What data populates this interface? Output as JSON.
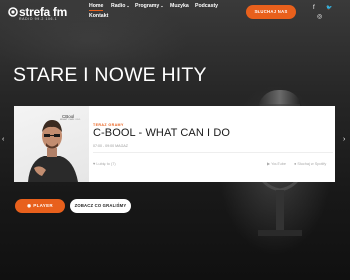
{
  "logo": {
    "name": "strefa fm",
    "tagline": "RADIO 99.2 106.1"
  },
  "nav": {
    "items": [
      {
        "label": "Home",
        "has_caret": false,
        "active": true
      },
      {
        "label": "Radio",
        "has_caret": true,
        "active": false
      },
      {
        "label": "Programy",
        "has_caret": true,
        "active": false
      },
      {
        "label": "Muzyka",
        "has_caret": false,
        "active": false
      },
      {
        "label": "Podcasty",
        "has_caret": false,
        "active": false
      },
      {
        "label": "Kontakt",
        "has_caret": false,
        "active": false
      }
    ],
    "caret": "⌄"
  },
  "header": {
    "listen_label": "SŁUCHAJ NAS",
    "social": {
      "facebook": "f",
      "twitter": "🐦",
      "instagram": "◎"
    }
  },
  "hero": {
    "title": "STARE I NOWE HITY",
    "prev_arrow": "‹",
    "next_arrow": "›"
  },
  "now_playing": {
    "label": "TERAZ GRAMY",
    "title": "C-BOOL - WHAT CAN I DO",
    "time": "07:00 - 09:00 MAGAZ",
    "cover_artist": "CBool",
    "cover_subtitle": "WHAT CAN I DO",
    "links": {
      "like_label": "Lubię to (7)",
      "youtube_label": "YouTube",
      "spotify_label": "Słuchaj w Spotify"
    }
  },
  "actions": {
    "player_label": "PLAYER",
    "played_label": "ZOBACZ CO GRALIŚMY"
  },
  "colors": {
    "accent": "#e8601c",
    "card_bg": "#ffffff",
    "hero_bg": "#1c1c1c"
  },
  "icons": {
    "logo": "strefa-logo-icon",
    "like": "heart-icon",
    "youtube": "youtube-icon",
    "spotify": "spotify-icon",
    "player": "play-circle-icon"
  }
}
